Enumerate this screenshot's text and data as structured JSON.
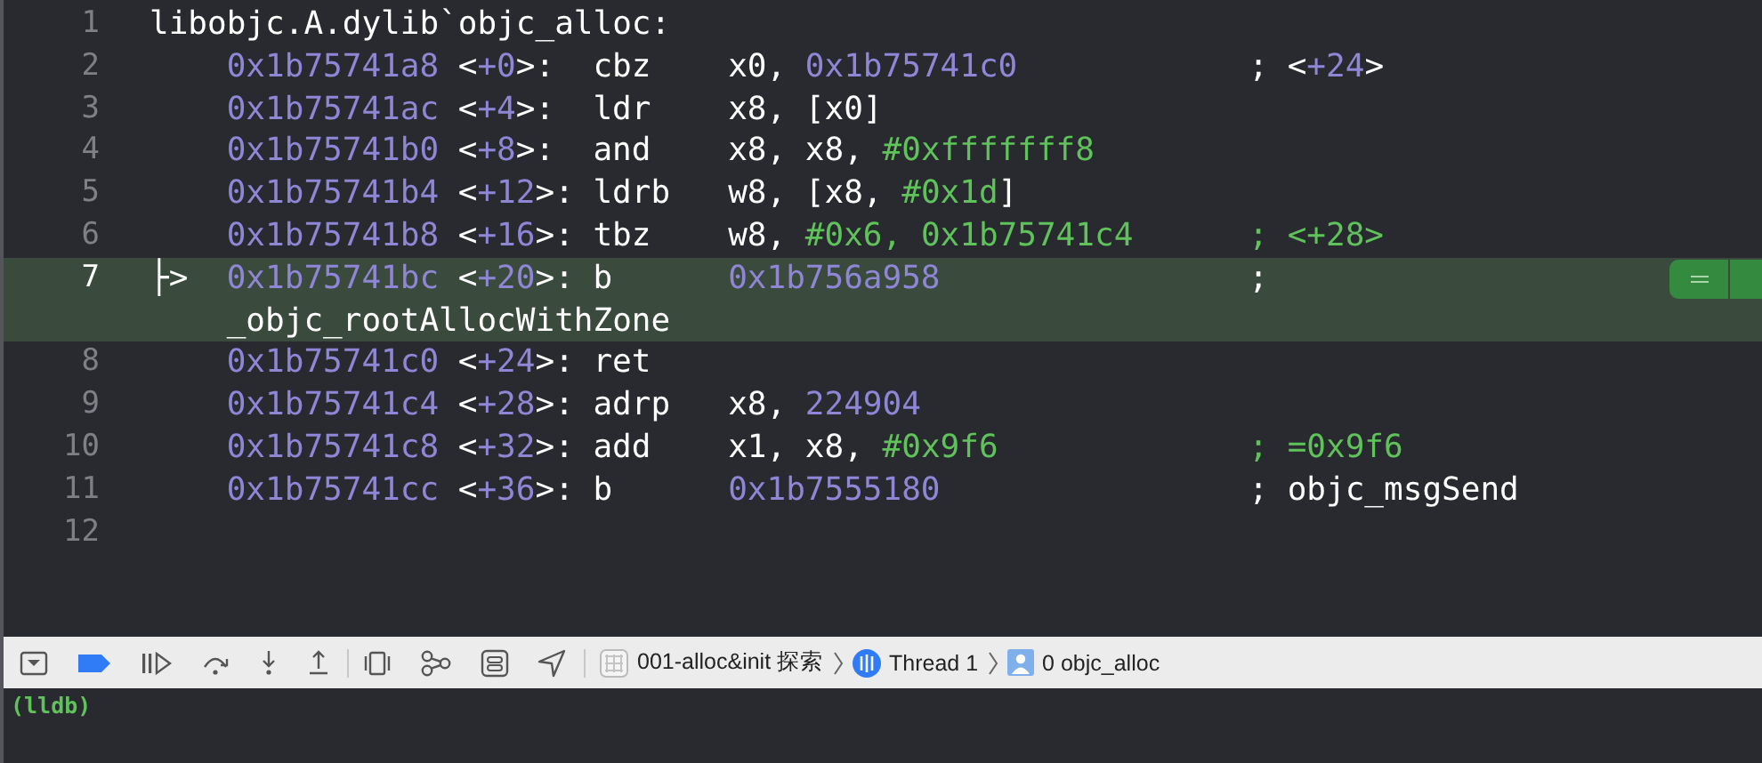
{
  "editor": {
    "lines": [
      {
        "number": "1",
        "kind": "label",
        "current": false,
        "text": "libobjc.A.dylib`objc_alloc:"
      },
      {
        "number": "2",
        "kind": "instruction",
        "current": false,
        "address": "0x1b75741a8",
        "offset": [
          {
            "text": "<",
            "kind": "plain"
          },
          {
            "text": "+0",
            "kind": "addr"
          },
          {
            "text": ">:",
            "kind": "plain"
          }
        ],
        "mnemonic": "cbz",
        "operands": [
          {
            "text": "x0, ",
            "kind": "plain"
          },
          {
            "text": "0x1b75741c0",
            "kind": "addr"
          }
        ],
        "comment": [
          {
            "text": "; <",
            "kind": "plain"
          },
          {
            "text": "+24",
            "kind": "addr"
          },
          {
            "text": ">",
            "kind": "plain"
          }
        ]
      },
      {
        "number": "3",
        "kind": "instruction",
        "current": false,
        "address": "0x1b75741ac",
        "offset": [
          {
            "text": "<",
            "kind": "plain"
          },
          {
            "text": "+4",
            "kind": "addr"
          },
          {
            "text": ">:",
            "kind": "plain"
          }
        ],
        "mnemonic": "ldr",
        "operands": [
          {
            "text": "x8, [x0]",
            "kind": "plain"
          }
        ]
      },
      {
        "number": "4",
        "kind": "instruction",
        "current": false,
        "address": "0x1b75741b0",
        "offset": [
          {
            "text": "<",
            "kind": "plain"
          },
          {
            "text": "+8",
            "kind": "addr"
          },
          {
            "text": ">:",
            "kind": "plain"
          }
        ],
        "mnemonic": "and",
        "operands": [
          {
            "text": "x8, x8, ",
            "kind": "plain"
          },
          {
            "text": "#0xfffffff8",
            "kind": "imm"
          }
        ]
      },
      {
        "number": "5",
        "kind": "instruction",
        "current": false,
        "address": "0x1b75741b4",
        "offset": [
          {
            "text": "<",
            "kind": "plain"
          },
          {
            "text": "+12",
            "kind": "addr"
          },
          {
            "text": ">:",
            "kind": "plain"
          }
        ],
        "mnemonic": "ldrb",
        "operands": [
          {
            "text": "w8, [x8, ",
            "kind": "plain"
          },
          {
            "text": "#0x1d",
            "kind": "imm"
          },
          {
            "text": "]",
            "kind": "plain"
          }
        ]
      },
      {
        "number": "6",
        "kind": "instruction",
        "current": false,
        "address": "0x1b75741b8",
        "offset": [
          {
            "text": "<",
            "kind": "plain"
          },
          {
            "text": "+16",
            "kind": "addr"
          },
          {
            "text": ">:",
            "kind": "plain"
          }
        ],
        "mnemonic": "tbz",
        "operands": [
          {
            "text": "w8, ",
            "kind": "plain"
          },
          {
            "text": "#0x6, 0x1b75741c4",
            "kind": "imm"
          }
        ],
        "comment": [
          {
            "text": "; <+28>",
            "kind": "imm"
          }
        ]
      },
      {
        "number": "7",
        "kind": "instruction",
        "current": true,
        "pc_marker": "├>",
        "address": "0x1b75741bc",
        "offset": [
          {
            "text": "<",
            "kind": "plain"
          },
          {
            "text": "+20",
            "kind": "addr"
          },
          {
            "text": ">:",
            "kind": "plain"
          }
        ],
        "mnemonic": "b",
        "operands": [
          {
            "text": "0x1b756a958",
            "kind": "addr"
          }
        ],
        "comment": [
          {
            "text": ";",
            "kind": "plain"
          }
        ],
        "continuation": "_objc_rootAllocWithZone"
      },
      {
        "number": "8",
        "kind": "instruction",
        "current": false,
        "address": "0x1b75741c0",
        "offset": [
          {
            "text": "<",
            "kind": "plain"
          },
          {
            "text": "+24",
            "kind": "addr"
          },
          {
            "text": ">:",
            "kind": "plain"
          }
        ],
        "mnemonic": "ret"
      },
      {
        "number": "9",
        "kind": "instruction",
        "current": false,
        "address": "0x1b75741c4",
        "offset": [
          {
            "text": "<",
            "kind": "plain"
          },
          {
            "text": "+28",
            "kind": "addr"
          },
          {
            "text": ">:",
            "kind": "plain"
          }
        ],
        "mnemonic": "adrp",
        "operands": [
          {
            "text": "x8, ",
            "kind": "plain"
          },
          {
            "text": "224904",
            "kind": "addr"
          }
        ]
      },
      {
        "number": "10",
        "kind": "instruction",
        "current": false,
        "address": "0x1b75741c8",
        "offset": [
          {
            "text": "<",
            "kind": "plain"
          },
          {
            "text": "+32",
            "kind": "addr"
          },
          {
            "text": ">:",
            "kind": "plain"
          }
        ],
        "mnemonic": "add",
        "operands": [
          {
            "text": "x1, x8, ",
            "kind": "plain"
          },
          {
            "text": "#0x9f6",
            "kind": "imm"
          }
        ],
        "comment": [
          {
            "text": "; =0x9f6",
            "kind": "imm"
          }
        ]
      },
      {
        "number": "11",
        "kind": "instruction",
        "current": false,
        "address": "0x1b75741cc",
        "offset": [
          {
            "text": "<",
            "kind": "plain"
          },
          {
            "text": "+36",
            "kind": "addr"
          },
          {
            "text": ">:",
            "kind": "plain"
          }
        ],
        "mnemonic": "b",
        "operands": [
          {
            "text": "0x1b7555180",
            "kind": "addr"
          }
        ],
        "comment": [
          {
            "text": "; objc_msgSend",
            "kind": "plain"
          }
        ]
      },
      {
        "number": "12",
        "kind": "empty",
        "current": false
      }
    ]
  },
  "debug_bar": {
    "breakpoints_active": true,
    "breadcrumbs": [
      {
        "kind": "app",
        "label": "001-alloc&init 探索"
      },
      {
        "kind": "thread",
        "label": "Thread 1"
      },
      {
        "kind": "frame",
        "label": "0 objc_alloc"
      }
    ]
  },
  "console": {
    "prompt": "(lldb)"
  }
}
